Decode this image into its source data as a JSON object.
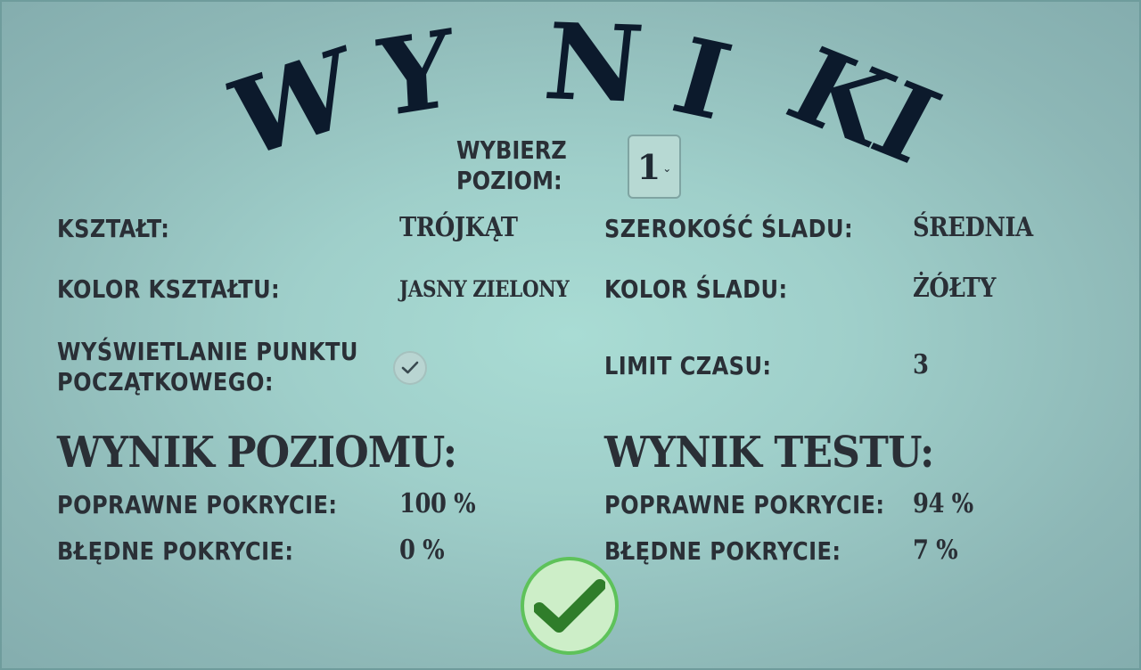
{
  "title": {
    "letters": [
      "W",
      "Y",
      "N",
      "I",
      "KI"
    ]
  },
  "level": {
    "label_line1": "WYBIERZ",
    "label_line2": "POZIOM:",
    "selected": "1"
  },
  "settings": {
    "shape": {
      "label": "KSZTAŁT:",
      "value": "TRÓJKĄT"
    },
    "trail_width": {
      "label": "SZEROKOŚĆ ŚLADU:",
      "value": "ŚREDNIA"
    },
    "shape_color": {
      "label": "KOLOR KSZTAŁTU:",
      "value": "JASNY ZIELONY"
    },
    "trail_color": {
      "label": "KOLOR ŚLADU:",
      "value": "ŻÓŁTY"
    },
    "start_point": {
      "label_line1": "WYŚWIETLANIE PUNKTU",
      "label_line2": "POCZĄTKOWEGO:",
      "checked": true
    },
    "time_limit": {
      "label": "LIMIT CZASU:",
      "value": "3"
    }
  },
  "level_result": {
    "heading": "WYNIK POZIOMU:",
    "correct_label": "POPRAWNE POKRYCIE:",
    "correct_value": "100 %",
    "wrong_label": "BŁĘDNE POKRYCIE:",
    "wrong_value": "0 %"
  },
  "test_result": {
    "heading": "WYNIK TESTU:",
    "correct_label": "POPRAWNE POKRYCIE:",
    "correct_value": "94 %",
    "wrong_label": "BŁĘDNE POKRYCIE:",
    "wrong_value": "7 %"
  },
  "icons": {
    "dropdown": "chevron-down-icon",
    "checkbox": "check-icon",
    "confirm": "check-icon"
  },
  "colors": {
    "title": "#0c1a2c",
    "text": "#2a2f36",
    "confirm_green": "#2f7d2a",
    "confirm_ring": "#5ec25a"
  }
}
